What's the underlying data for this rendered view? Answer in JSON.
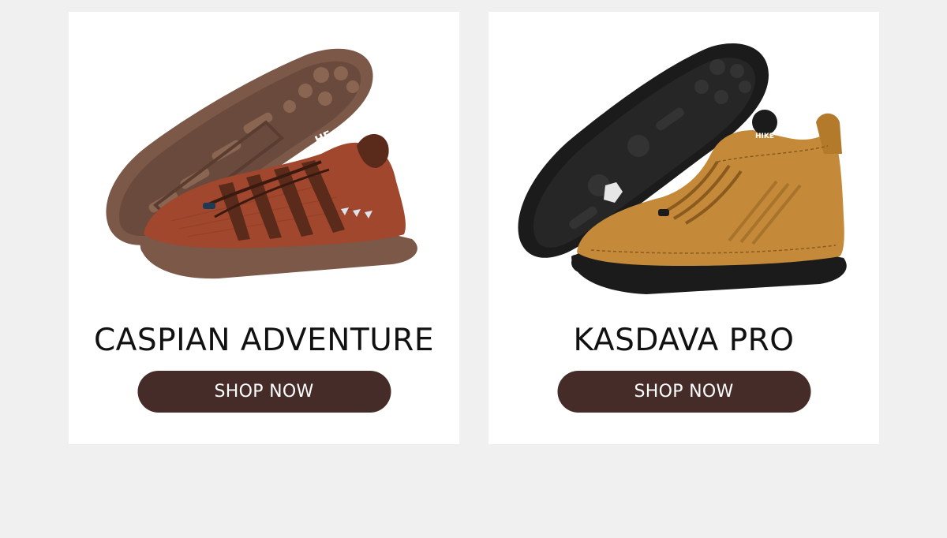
{
  "products": [
    {
      "name": "CASPIAN ADVENTURE",
      "button_label": "SHOP NOW",
      "colors": {
        "upper": "#a0472d",
        "sole": "#7b5848",
        "laces": "#5a2a1a"
      },
      "sole_logo": "HF"
    },
    {
      "name": "KASDAVA PRO",
      "button_label": "SHOP NOW",
      "colors": {
        "upper": "#c48a3a",
        "sole": "#1b1b1b",
        "laces": "#8a5a1e"
      },
      "tongue_logo": "HIKE"
    }
  ],
  "theme": {
    "background": "#f0f0f0",
    "card": "#ffffff",
    "button": "#452c28",
    "button_text": "#ffffff",
    "title_text": "#111111"
  }
}
